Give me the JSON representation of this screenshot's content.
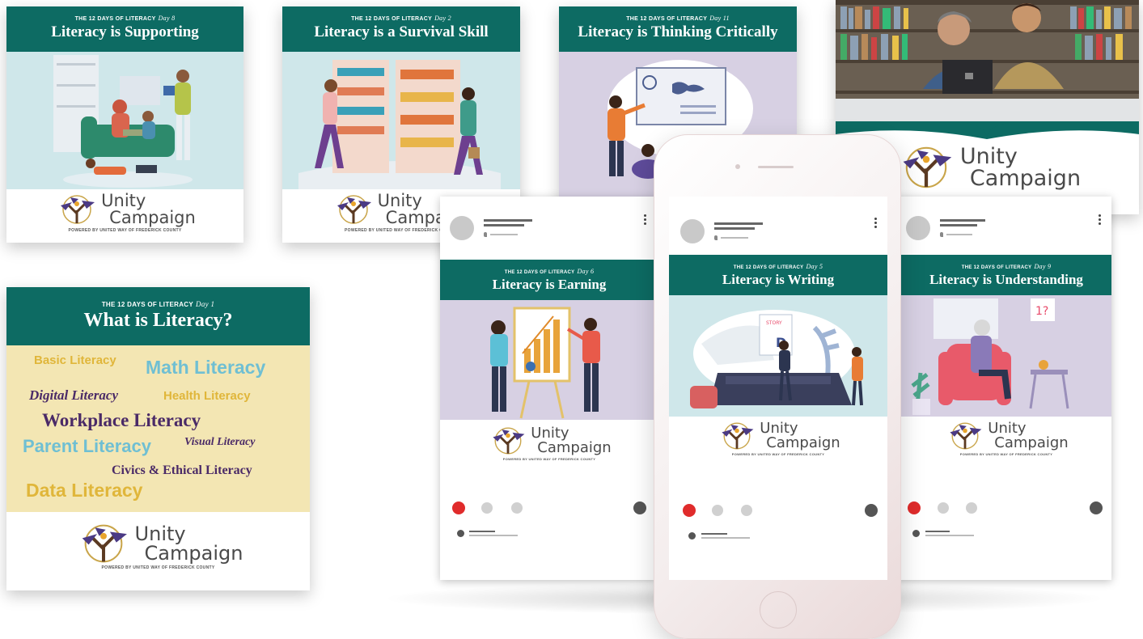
{
  "kicker": "THE 12 DAYS OF LITERACY",
  "cards": {
    "day8": {
      "day": "Day 8",
      "title": "Literacy is Supporting"
    },
    "day2": {
      "day": "Day 2",
      "title": "Literacy is a Survival Skill"
    },
    "day11": {
      "day": "Day 11",
      "title": "Literacy is Thinking Critically"
    },
    "day1": {
      "day": "Day 1",
      "title": "What is Literacy?"
    },
    "day6": {
      "day": "Day 6",
      "title": "Literacy is Earning"
    },
    "day5": {
      "day": "Day 5",
      "title": "Literacy is Writing"
    },
    "day9": {
      "day": "Day 9",
      "title": "Literacy is Understanding"
    }
  },
  "word_cloud": [
    "Basic Literacy",
    "Math Literacy",
    "Digital Literacy",
    "Health Literacy",
    "Workplace Literacy",
    "Parent Literacy",
    "Visual Literacy",
    "Civics & Ethical Literacy",
    "Data Literacy"
  ],
  "logo": {
    "word1": "Unity",
    "word2": "Campaign",
    "tagline": "POWERED BY UNITED WAY OF FREDERICK COUNTY"
  },
  "colors": {
    "teal": "#0d6b63",
    "lavender": "#d7d0e3",
    "light_blue": "#cfe7ea",
    "cream": "#f3e6b3",
    "accent_red": "#e02b2b",
    "word_gold": "#e0b63a",
    "word_blue": "#6fbfd3",
    "word_purple": "#4a2a67"
  },
  "carousel": {
    "active_dot_color": "#e02b2b",
    "inactive_dot_color": "#d0d0d0"
  }
}
